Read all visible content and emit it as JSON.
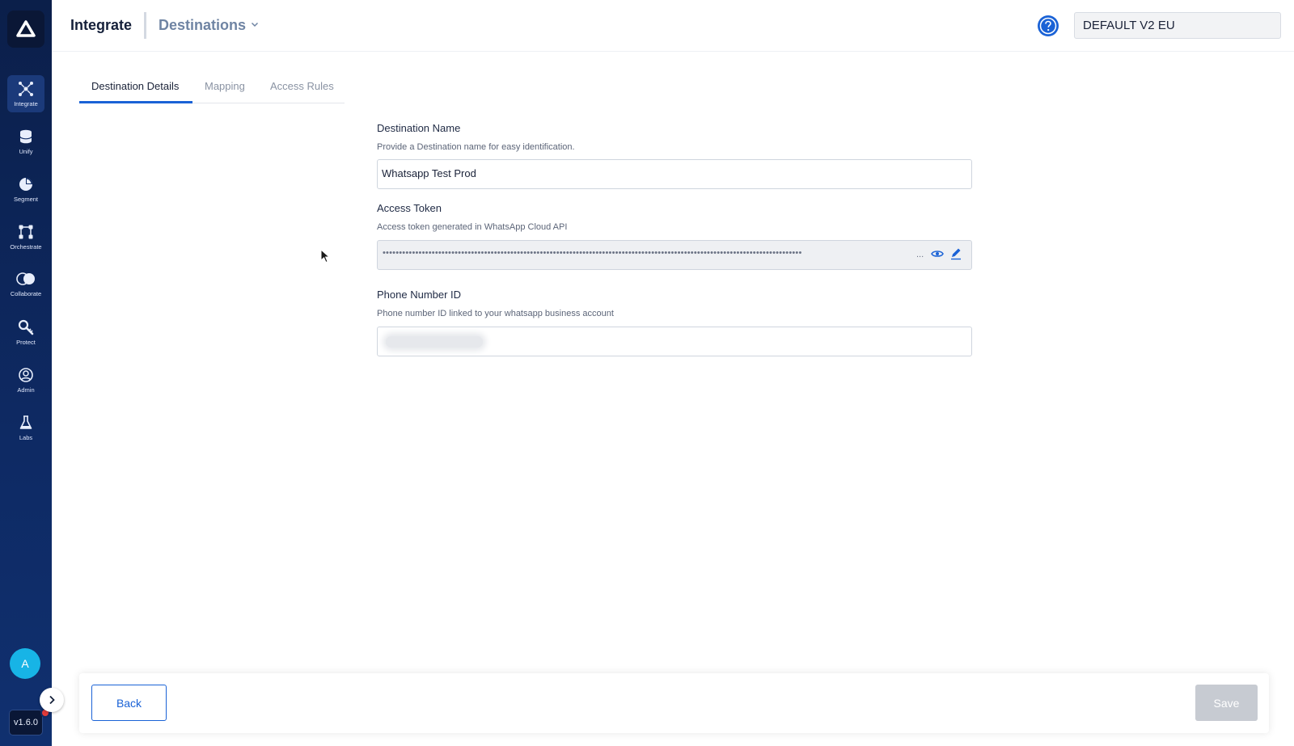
{
  "header": {
    "title": "Integrate",
    "subtitle": "Destinations",
    "environment": "DEFAULT V2 EU"
  },
  "sidebar": {
    "items": [
      {
        "label": "Integrate",
        "icon": "integrate-icon",
        "active": true
      },
      {
        "label": "Unify",
        "icon": "database-icon"
      },
      {
        "label": "Segment",
        "icon": "pie-chart-icon"
      },
      {
        "label": "Orchestrate",
        "icon": "workflow-icon"
      },
      {
        "label": "Collaborate",
        "icon": "overlap-circles-icon"
      },
      {
        "label": "Protect",
        "icon": "key-search-icon"
      },
      {
        "label": "Admin",
        "icon": "user-circle-icon"
      },
      {
        "label": "Labs",
        "icon": "flask-icon"
      }
    ],
    "avatar_initial": "A",
    "version": "v1.6.0"
  },
  "tabs": [
    {
      "label": "Destination Details",
      "active": true
    },
    {
      "label": "Mapping"
    },
    {
      "label": "Access Rules"
    }
  ],
  "form": {
    "destination_name": {
      "label": "Destination Name",
      "help": "Provide a Destination name for easy identification.",
      "value": "Whatsapp Test Prod"
    },
    "access_token": {
      "label": "Access Token",
      "help": "Access token generated in WhatsApp Cloud API",
      "masked_value": "••••••••••••••••••••••••••••••••••••••••••••••••••••••••••••••••••••••••••••••••••••••••••••••••••••••••••••••••••••••••••••••••",
      "ellipsis": "..."
    },
    "phone_number_id": {
      "label": "Phone Number ID",
      "help": "Phone number ID linked to your whatsapp business account"
    }
  },
  "footer": {
    "back_label": "Back",
    "save_label": "Save"
  },
  "colors": {
    "accent": "#1a62d6",
    "sidebar": "#0e2a64",
    "avatar": "#17b4e6"
  }
}
